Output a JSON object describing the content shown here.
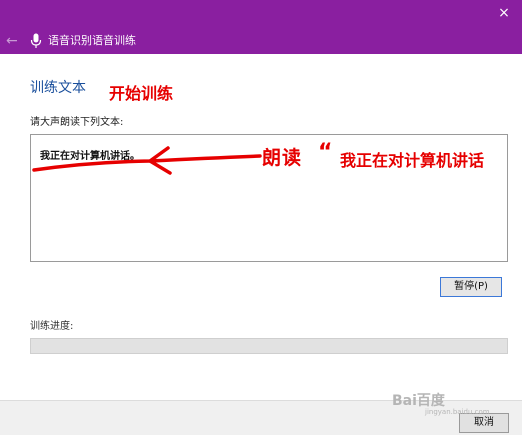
{
  "window": {
    "close_glyph": "×",
    "title_color": "#8a1fa0"
  },
  "nav": {
    "back_icon": "back-arrow-icon",
    "mic_icon": "microphone-icon",
    "title": "语音识别语音训练"
  },
  "main": {
    "heading": "训练文本",
    "instruction": "请大声朗读下列文本:",
    "read_text": "我正在对计算机讲话。"
  },
  "annotations": {
    "start": "开始训练",
    "read_prefix": "朗读",
    "quote_mark": "“",
    "read_phrase": "我正在对计算机讲话",
    "color": "#e60000"
  },
  "controls": {
    "pause_label": "暂停(P)",
    "cancel_label": "取消"
  },
  "progress": {
    "label": "训练进度:",
    "value": 0
  },
  "watermark": {
    "text": "Bai百度",
    "sub": "jingyan.baidu.com"
  }
}
